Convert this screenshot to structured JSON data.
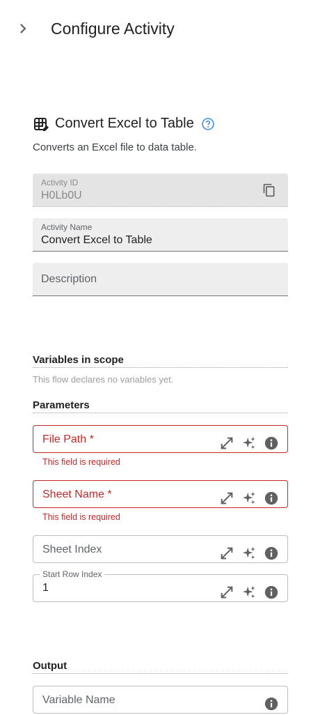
{
  "header": {
    "title": "Configure Activity"
  },
  "activity": {
    "title": "Convert Excel to Table",
    "description": "Converts an Excel file to data table."
  },
  "fields": {
    "activity_id": {
      "label": "Activity ID",
      "value": "H0Lb0U"
    },
    "activity_name": {
      "label": "Activity Name",
      "value": "Convert Excel to Table"
    },
    "description": {
      "placeholder": "Description"
    }
  },
  "variables": {
    "heading": "Variables in scope",
    "empty_text": "This flow declares no variables yet."
  },
  "parameters": {
    "heading": "Parameters",
    "file_path": {
      "label": "File Path *",
      "error": "This field is required"
    },
    "sheet_name": {
      "label": "Sheet Name *",
      "error": "This field is required"
    },
    "sheet_index": {
      "label": "Sheet Index"
    },
    "start_row_index": {
      "label": "Start Row Index",
      "value": "1"
    }
  },
  "output": {
    "heading": "Output",
    "variable_name": {
      "placeholder": "Variable Name"
    }
  },
  "colors": {
    "accent": "#4a90e2",
    "error": "#c62828",
    "icon": "#616161"
  }
}
